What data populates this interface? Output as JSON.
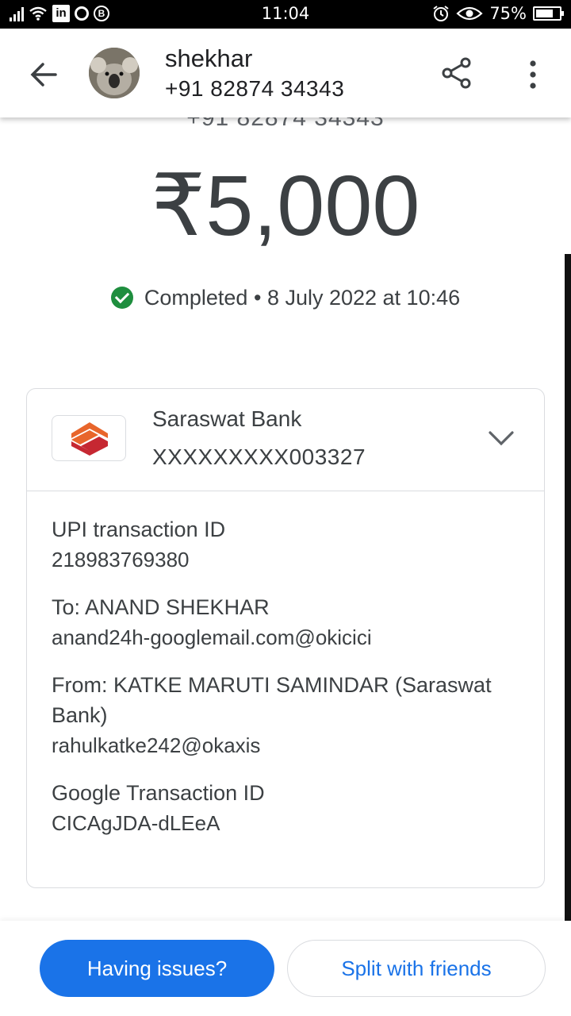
{
  "status_bar": {
    "time": "11:04",
    "battery": "75%",
    "battery_level": 0.75,
    "icons": [
      "signal-icon",
      "wifi-icon",
      "linkedin-icon",
      "circle-app-icon",
      "b-app-icon",
      "alarm-icon",
      "eye-icon",
      "battery-icon"
    ]
  },
  "header": {
    "contact_name": "shekhar",
    "contact_phone": "+91 82874 34343",
    "icons": [
      "back-arrow-icon",
      "share-icon",
      "more-vert-icon"
    ]
  },
  "payment": {
    "phone_partial": "+91 82874 34343",
    "amount": "₹5,000",
    "status": "Completed",
    "separator": "•",
    "date": "8 July 2022 at 10:46",
    "status_color": "#1e8e3e"
  },
  "bank": {
    "name": "Saraswat Bank",
    "account": "XXXXXXXXX003327",
    "logo_colors": [
      "#e8652b",
      "#c62832"
    ]
  },
  "details": [
    {
      "label": "UPI transaction ID",
      "value": "218983769380"
    },
    {
      "label": "To: ANAND SHEKHAR",
      "value": "anand24h-googlemail.com@okicici"
    },
    {
      "label": "From: KATKE MARUTI SAMINDAR (Saraswat Bank)",
      "value": "rahulkatke242@okaxis"
    },
    {
      "label": "Google Transaction ID",
      "value": "CICAgJDA-dLEeA"
    }
  ],
  "actions": {
    "having_issues": "Having issues?",
    "split": "Split with friends",
    "accent": "#1a73e8"
  }
}
